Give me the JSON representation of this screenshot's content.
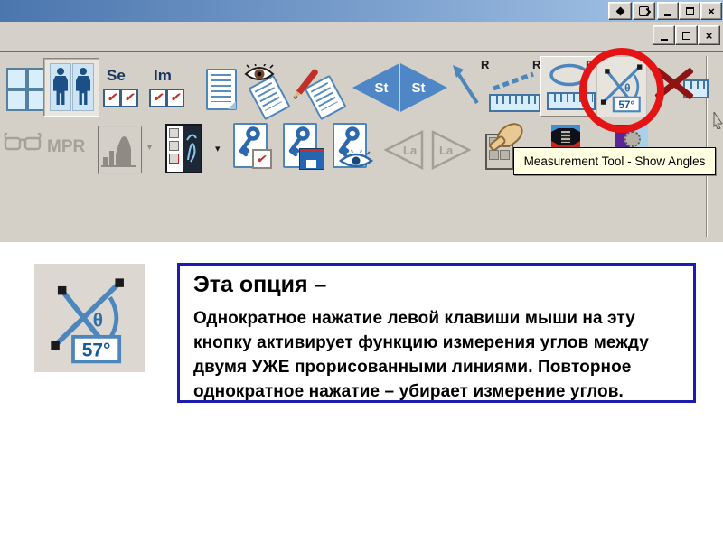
{
  "window": {
    "close_glyph": "×"
  },
  "toolbar": {
    "labels": {
      "se": "Se",
      "im": "Im",
      "st": "St",
      "r": "R",
      "mpr": "MPR",
      "la": "La"
    },
    "check_glyph": "✔",
    "dropdown_glyph": "▾",
    "angle_icon": {
      "theta": "θ",
      "value": "57°"
    },
    "tooltip": "Measurement Tool - Show Angles"
  },
  "callout": {
    "title": "Эта опция –",
    "body": "Однократное нажатие левой клавиши мыши на эту\nкнопку  активирует функцию измерения углов между\nдвумя УЖЕ прорисованными линиями. Повторное\nоднократное нажатие – убирает измерение углов."
  },
  "colors": {
    "titlebar_left": "#4a76ae",
    "titlebar_right": "#a9c8ea",
    "toolbar_bg": "#d4d0c8",
    "icon_blue": "#4c86bc",
    "check_red": "#c23028",
    "highlight_red": "#e41414",
    "tooltip_bg": "#ffffe1",
    "callout_border": "#1c1cae",
    "disabled_gray": "#a5a199"
  }
}
